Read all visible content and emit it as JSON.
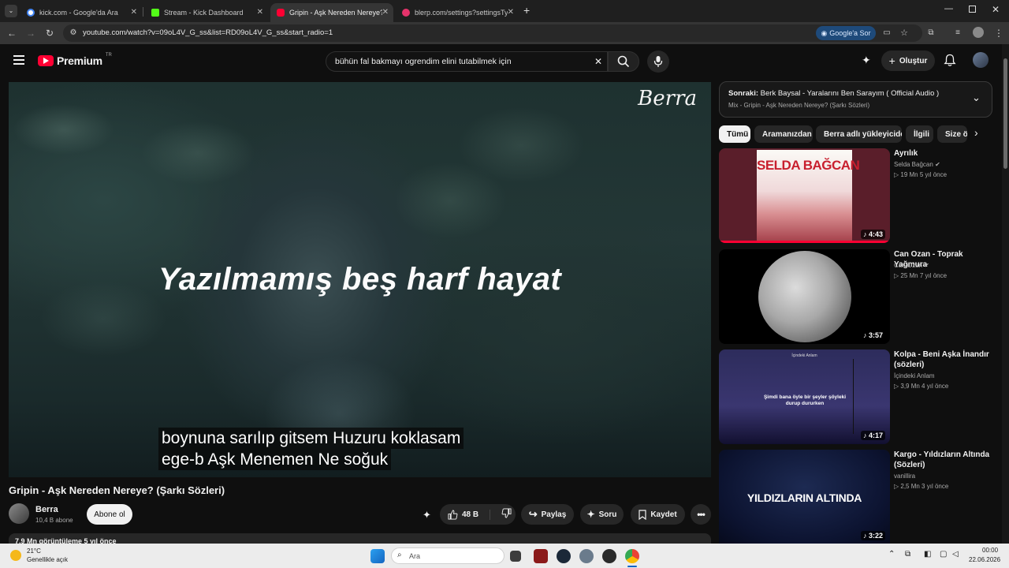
{
  "tabs": [
    {
      "title": "kick.com - Google'da Ara",
      "color": "#4285f4"
    },
    {
      "title": "Stream - Kick Dashboard",
      "color": "#53fc18"
    },
    {
      "title": "Gripin - Aşk Nereden Nereye? (",
      "color": "#ff0033"
    },
    {
      "title": "blerp.com/settings?settingsTyp",
      "color": "#e5336b"
    }
  ],
  "address": {
    "url": "youtube.com/watch?v=09oL4V_G_ss&list=RD09oL4V_G_ss&start_radio=1",
    "google_button": "Google'a Sor"
  },
  "youtube": {
    "logo": "Premium",
    "country": "TR",
    "search_query": "bühün fal bakmayı ogrendim elini tutabilmek için",
    "create_label": "Oluştur"
  },
  "video": {
    "watermark": "Berra",
    "lyric_main": "Yazılmamış beş harf hayat",
    "caption_line1": "boynuna sarılıp gitsem Huzuru koklasam",
    "caption_line2": "ege-b Aşk Menemen Ne soğuk",
    "title": "Gripin - Aşk Nereden Nereye? (Şarkı Sözleri)",
    "channel": "Berra",
    "subscribers": "10,4 B abone",
    "subscribe_label": "Abone ol",
    "likes": "48 B",
    "share_label": "Paylaş",
    "ask_label": "Soru",
    "save_label": "Kaydet",
    "views_partial": "7,9 Mn görüntüleme  5 yıl önce"
  },
  "up_next": {
    "prefix": "Sonraki:",
    "title": "Berk Baysal - Yaralarını Ben Sarayım ( Official Audio )",
    "mix": "Mix - Gripin - Aşk Nereden Nereye? (Şarkı Sözleri)"
  },
  "chips": [
    "Tümü",
    "Aramanızdan",
    "Berra adlı yükleyiciden",
    "İlgili",
    "Size ö"
  ],
  "recommendations": [
    {
      "title": "Ayrılık",
      "channel": "Selda Bağcan",
      "verified": true,
      "meta": "19 Mn  5 yıl önce",
      "duration": "4:43",
      "thumb_text": "SELDA BAĞCAN"
    },
    {
      "title": "Can Ozan - Toprak Yağmura",
      "channel": "Can Ozan",
      "verified": true,
      "meta": "25 Mn  7 yıl önce",
      "duration": "3:57",
      "thumb_text": ""
    },
    {
      "title": "Kolpa - Beni Aşka İnandır (sözleri)",
      "channel": "İçindeki Anlam",
      "verified": false,
      "meta": "3,9 Mn  4 yıl önce",
      "duration": "4:17",
      "thumb_text": "Şimdi bana öyle bir şeyler şöyleki durup dururken",
      "thumb_small": "İçindeki Anlam"
    },
    {
      "title": "Kargo - Yıldızların Altında (Sözleri)",
      "channel": "vanillira",
      "verified": false,
      "meta": "2,5 Mn  3 yıl önce",
      "duration": "3:22",
      "thumb_text": "YILDIZLARIN ALTINDA"
    }
  ],
  "taskbar": {
    "temp": "21°C",
    "weather": "Genellikle açık",
    "search_placeholder": "Ara",
    "time": "00:00",
    "date": "22.06.2026"
  }
}
